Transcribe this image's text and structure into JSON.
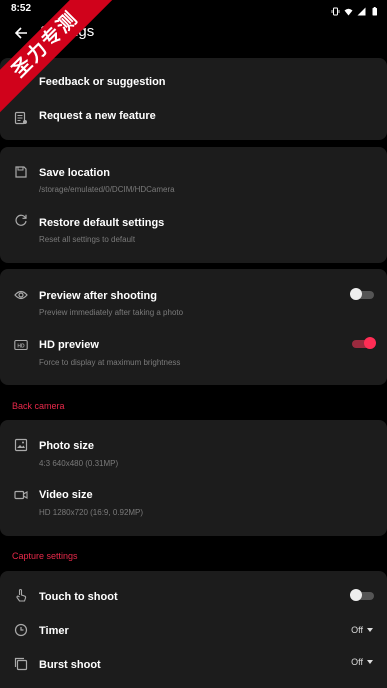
{
  "status": {
    "time": "8:52"
  },
  "title": "Settings",
  "banner": "圣力专测",
  "group1": [
    {
      "title": "Feedback or suggestion",
      "icon": "feedback-icon"
    },
    {
      "title": "Request a new feature",
      "icon": "feature-request-icon"
    }
  ],
  "group2": {
    "save": {
      "title": "Save location",
      "sub": "/storage/emulated/0/DCIM/HDCamera"
    },
    "restore": {
      "title": "Restore default settings",
      "sub": "Reset all settings to default"
    }
  },
  "group3": {
    "preview": {
      "title": "Preview after shooting",
      "sub": "Preview immediately after taking a photo",
      "on": false
    },
    "hd": {
      "title": "HD preview",
      "sub": "Force to display at maximum brightness",
      "on": true
    }
  },
  "back_camera": {
    "header": "Back camera",
    "photo": {
      "title": "Photo size",
      "sub": "4:3 640x480 (0.31MP)"
    },
    "video": {
      "title": "Video size",
      "sub": "HD 1280x720 (16:9, 0.92MP)"
    }
  },
  "capture": {
    "header": "Capture settings",
    "touch": {
      "title": "Touch to shoot",
      "on": false
    },
    "timer": {
      "title": "Timer",
      "value": "Off"
    },
    "burst": {
      "title": "Burst shoot",
      "value": "Off"
    }
  },
  "colors": {
    "accent": "#ff2d55",
    "section": "#e8294a",
    "card": "#1c1c1c"
  }
}
